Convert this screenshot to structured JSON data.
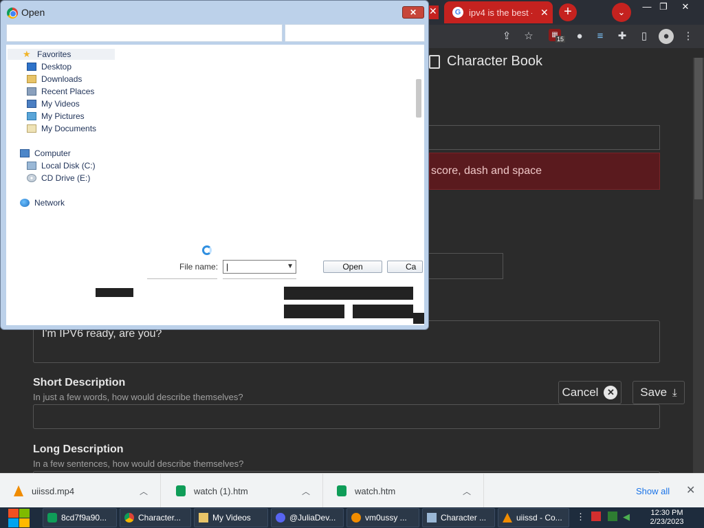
{
  "browser": {
    "tabs": [
      {
        "title": "ipv4 is the best -",
        "favicon": "G",
        "close": "✕"
      }
    ],
    "new_tab": "+",
    "tab_search": "⌄",
    "window_controls": {
      "minimize": "—",
      "restore": "❐",
      "close": "✕"
    },
    "extension_badge": "15"
  },
  "page": {
    "title": "Character Book",
    "error_text": "score, dash and space",
    "quote_value": "I'm IPV6 ready, are you?",
    "short_description": {
      "label": "Short Description",
      "help": "In just a few words, how would describe themselves?"
    },
    "long_description": {
      "label": "Long Description",
      "help": "In a few sentences, how would describe themselves?"
    },
    "cancel_label": "Cancel",
    "save_label": "Save"
  },
  "dialog": {
    "title": "Open",
    "close": "✕",
    "nav": {
      "favorites": "Favorites",
      "desktop": "Desktop",
      "downloads": "Downloads",
      "recent": "Recent Places",
      "videos": "My Videos",
      "pictures": "My Pictures",
      "documents": "My Documents",
      "computer": "Computer",
      "local_disk": "Local Disk (C:)",
      "cd_drive": "CD Drive (E:)",
      "network": "Network"
    },
    "file_name_label": "File name:",
    "file_name_value": "|",
    "open_label": "Open",
    "cancel_label": "Ca"
  },
  "downloads": {
    "items": [
      {
        "name": "uiissd.mp4",
        "icon": "vlc-icon"
      },
      {
        "name": "watch (1).htm",
        "icon": "sheet-icon"
      },
      {
        "name": "watch.htm",
        "icon": "sheet-icon"
      }
    ],
    "show_all": "Show all",
    "close": "✕"
  },
  "taskbar": {
    "tasks": [
      {
        "label": "8cd7f9a90...",
        "icon": "sheets-icon",
        "color": "#0f9d58"
      },
      {
        "label": "Character...",
        "icon": "chrome-icon",
        "color": "#4285f4"
      },
      {
        "label": "My Videos",
        "icon": "folder-icon",
        "color": "#e8c468"
      },
      {
        "label": "@JuliaDev...",
        "icon": "discord-icon",
        "color": "#5865f2"
      },
      {
        "label": "vm0ussy ...",
        "icon": "x-app-icon",
        "color": "#f08c00"
      },
      {
        "label": "Character ...",
        "icon": "app-icon",
        "color": "#9ab8d6"
      },
      {
        "label": "uiissd - Co...",
        "icon": "vlc-icon",
        "color": "#f08c00"
      }
    ],
    "time": "12:30 PM",
    "date": "2/23/2023"
  }
}
